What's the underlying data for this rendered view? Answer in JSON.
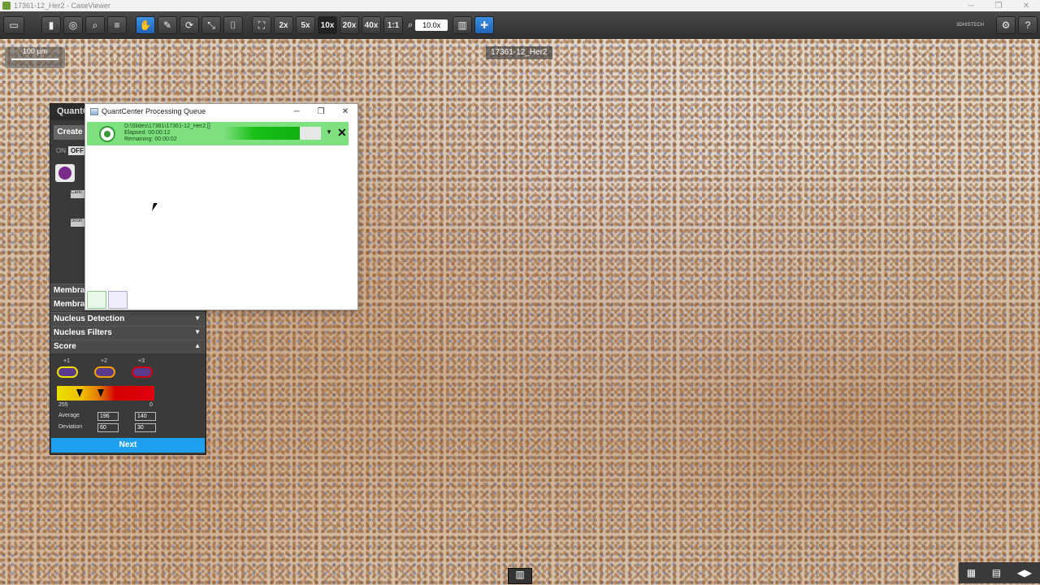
{
  "window": {
    "title": "17361-12_Her2 - CaseViewer",
    "controls": [
      "─",
      "❐",
      "✕"
    ]
  },
  "toolbar": {
    "zoom_levels": [
      "2x",
      "5x",
      "10x",
      "20x",
      "40x"
    ],
    "one_to_one": "1:1",
    "zoom_value": "10.0x",
    "brand": "3DHISTECH"
  },
  "slide": {
    "label": "17361-12_Her2",
    "scale": "100 µm"
  },
  "quant_panel": {
    "header": "QuantC",
    "create": "Create",
    "on": "ON",
    "off": "OFF",
    "mini1": "Canc",
    "mini2": "Stron",
    "sections": [
      "Membra",
      "Membra",
      "Nucleus Detection",
      "Nucleus Filters",
      "Score"
    ],
    "score_levels": [
      "+1",
      "+2",
      "+3"
    ],
    "range_min": "255",
    "range_max": "0",
    "average_label": "Average",
    "deviation_label": "Deviation",
    "average_a": "196",
    "average_b": "140",
    "deviation_a": "60",
    "deviation_b": "30",
    "next": "Next"
  },
  "queue": {
    "title": "QuantCenter Processing Queue",
    "job": {
      "path": "D:\\Slides\\17361\\17361-12_Her2.[]",
      "elapsed": "Elapsed: 00:00:12",
      "remaining": "Remaining: 00:00:02",
      "progress": 0.78
    }
  },
  "colors": {
    "accent": "#1ea0f0",
    "progress": "#10b010",
    "panel": "#3a3a3a"
  }
}
